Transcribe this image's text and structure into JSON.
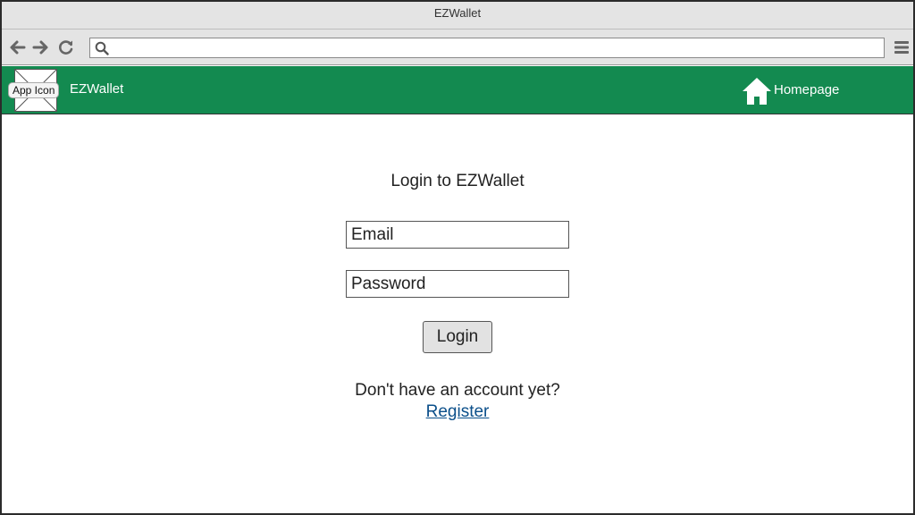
{
  "window": {
    "title": "EZWallet"
  },
  "browser": {
    "back_icon": "arrow-left-icon",
    "forward_icon": "arrow-right-icon",
    "reload_icon": "reload-icon",
    "search_icon": "search-icon",
    "menu_icon": "hamburger-menu-icon",
    "address_value": ""
  },
  "appbar": {
    "icon_label": "App Icon",
    "app_name": "EZWallet",
    "home_icon": "home-icon",
    "home_label": "Homepage",
    "background_color": "#138a50"
  },
  "login": {
    "title": "Login to EZWallet",
    "email_placeholder": "Email",
    "password_placeholder": "Password",
    "button_label": "Login",
    "no_account_text": "Don't have an account yet?",
    "register_label": "Register",
    "link_color": "#0b4f8a"
  }
}
